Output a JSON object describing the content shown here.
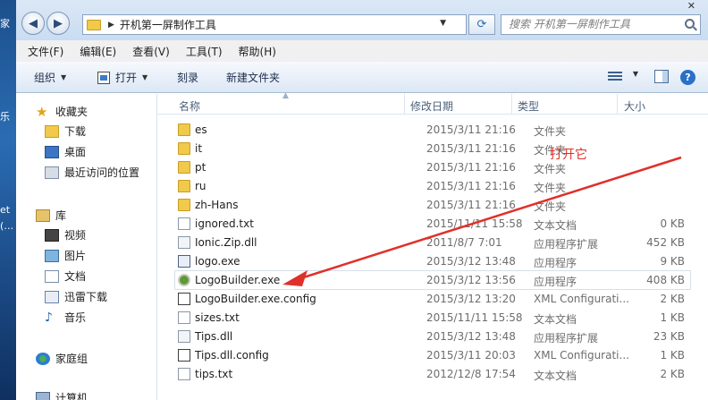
{
  "desktop_strip": {
    "items": [
      "家",
      "乐",
      "et",
      "(…"
    ]
  },
  "address_bar": {
    "path": "开机第一屏制作工具",
    "search_placeholder": "搜索 开机第一屏制作工具"
  },
  "menu": [
    "文件(F)",
    "编辑(E)",
    "查看(V)",
    "工具(T)",
    "帮助(H)"
  ],
  "toolbar": {
    "organize": "组织",
    "open": "打开",
    "burn": "刻录",
    "new_folder": "新建文件夹"
  },
  "nav": {
    "favorites": "收藏夹",
    "favorites_items": [
      "下载",
      "桌面",
      "最近访问的位置"
    ],
    "libraries": "库",
    "library_items": [
      "视频",
      "图片",
      "文档",
      "迅雷下载",
      "音乐"
    ],
    "homegroup": "家庭组",
    "computer": "计算机"
  },
  "columns": {
    "name": "名称",
    "date": "修改日期",
    "type": "类型",
    "size": "大小"
  },
  "files": [
    {
      "name": "es",
      "date": "2015/3/11 21:16",
      "type": "文件夹",
      "size": "",
      "icon": "folder-icon"
    },
    {
      "name": "it",
      "date": "2015/3/11 21:16",
      "type": "文件夹",
      "size": "",
      "icon": "folder-icon"
    },
    {
      "name": "pt",
      "date": "2015/3/11 21:16",
      "type": "文件夹",
      "size": "",
      "icon": "folder-icon"
    },
    {
      "name": "ru",
      "date": "2015/3/11 21:16",
      "type": "文件夹",
      "size": "",
      "icon": "folder-icon"
    },
    {
      "name": "zh-Hans",
      "date": "2015/3/11 21:16",
      "type": "文件夹",
      "size": "",
      "icon": "folder-icon"
    },
    {
      "name": "ignored.txt",
      "date": "2015/11/11 15:58",
      "type": "文本文档",
      "size": "0 KB",
      "icon": "text-file-icon"
    },
    {
      "name": "Ionic.Zip.dll",
      "date": "2011/8/7 7:01",
      "type": "应用程序扩展",
      "size": "452 KB",
      "icon": "dll-file-icon"
    },
    {
      "name": "logo.exe",
      "date": "2015/3/12 13:48",
      "type": "应用程序",
      "size": "9 KB",
      "icon": "exe-file-icon"
    },
    {
      "name": "LogoBuilder.exe",
      "date": "2015/3/12 13:56",
      "type": "应用程序",
      "size": "408 KB",
      "icon": "logobuilder-app-icon"
    },
    {
      "name": "LogoBuilder.exe.config",
      "date": "2015/3/12 13:20",
      "type": "XML Configurati...",
      "size": "2 KB",
      "icon": "config-file-icon"
    },
    {
      "name": "sizes.txt",
      "date": "2015/11/11 15:58",
      "type": "文本文档",
      "size": "1 KB",
      "icon": "text-file-icon"
    },
    {
      "name": "Tips.dll",
      "date": "2015/3/12 13:48",
      "type": "应用程序扩展",
      "size": "23 KB",
      "icon": "dll-file-icon"
    },
    {
      "name": "Tips.dll.config",
      "date": "2015/3/11 20:03",
      "type": "XML Configurati...",
      "size": "1 KB",
      "icon": "config-file-icon"
    },
    {
      "name": "tips.txt",
      "date": "2012/12/8 17:54",
      "type": "文本文档",
      "size": "2 KB",
      "icon": "text-file-icon"
    }
  ],
  "annotation": {
    "text": "打开它",
    "color": "#e0302a"
  }
}
